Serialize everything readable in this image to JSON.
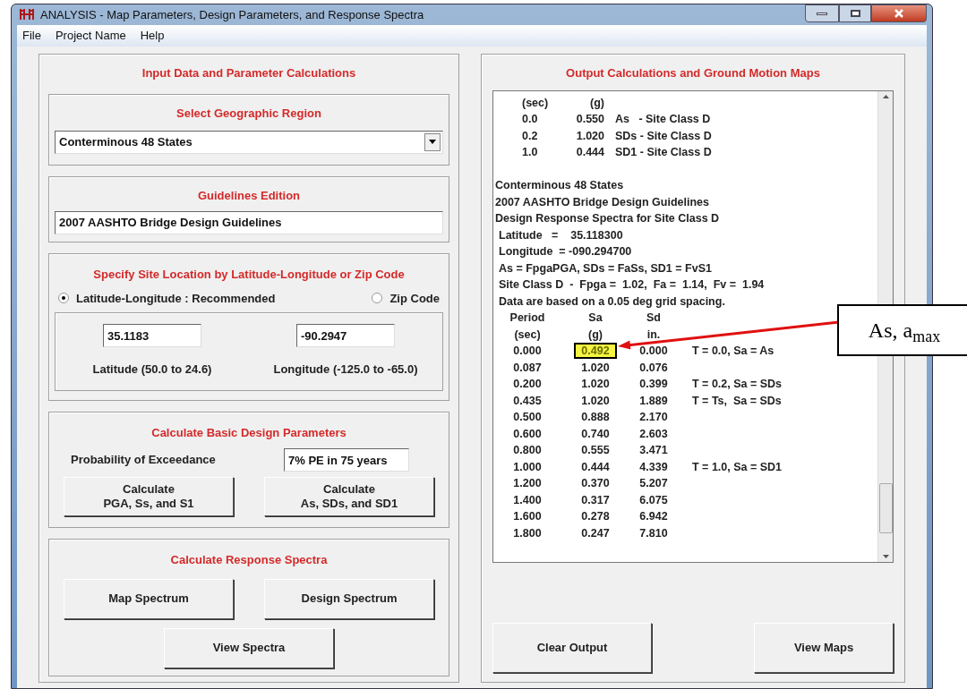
{
  "window": {
    "title": "ANALYSIS - Map Parameters, Design Parameters, and Response Spectra"
  },
  "menu": [
    "File",
    "Project Name",
    "Help"
  ],
  "input_panel": {
    "title": "Input Data and Parameter Calculations",
    "region": {
      "title": "Select Geographic Region",
      "value": "Conterminous 48 States"
    },
    "edition": {
      "title": "Guidelines Edition",
      "value": "2007 AASHTO Bridge Design Guidelines"
    },
    "site": {
      "title": "Specify Site Location by Latitude-Longitude or Zip Code",
      "options": [
        {
          "label": "Latitude-Longitude : Recommended",
          "selected": true
        },
        {
          "label": "Zip Code",
          "selected": false
        }
      ],
      "fields": [
        {
          "value": "35.1183",
          "label": "Latitude (50.0 to 24.6)"
        },
        {
          "value": "-90.2947",
          "label": "Longitude (-125.0 to -65.0)"
        }
      ]
    },
    "basic": {
      "title": "Calculate Basic Design Parameters",
      "probability_label": "Probability of Exceedance",
      "probability_value": "7% PE in 75 years",
      "buttons": [
        [
          "Calculate",
          "PGA, Ss, and S1"
        ],
        [
          "Calculate",
          "As, SDs, and SD1"
        ]
      ]
    },
    "spectra": {
      "title": "Calculate Response Spectra",
      "buttons": [
        "Map Spectrum",
        "Design Spectrum",
        "View Spectra"
      ]
    }
  },
  "output_panel": {
    "title": "Output Calculations and Ground Motion Maps",
    "lines": [
      {
        "kind": "summary",
        "cells": [
          "(sec)",
          "(g)"
        ]
      },
      {
        "kind": "summary",
        "cells": [
          "0.0",
          "0.550",
          "As   - Site Class D"
        ]
      },
      {
        "kind": "summary",
        "cells": [
          "0.2",
          "1.020",
          "SDs - Site Class D"
        ]
      },
      {
        "kind": "summary",
        "cells": [
          "1.0",
          "0.444",
          "SD1 - Site Class D"
        ]
      },
      {
        "kind": "blank"
      },
      {
        "kind": "text",
        "text": "Conterminous 48 States"
      },
      {
        "kind": "text",
        "text": "2007 AASHTO Bridge Design Guidelines"
      },
      {
        "kind": "text",
        "text": "Design Response Spectra for Site Class D"
      },
      {
        "kind": "indented",
        "text": "Latitude   =    35.118300"
      },
      {
        "kind": "indented",
        "text": "Longitude  = -090.294700"
      },
      {
        "kind": "indented",
        "text": "As = FpgaPGA, SDs = FaSs, SD1 = FvS1"
      },
      {
        "kind": "indented",
        "text": "Site Class D  -  Fpga =  1.02,  Fa =  1.14,  Fv =  1.94"
      },
      {
        "kind": "indented",
        "text": "Data are based on a 0.05 deg grid spacing."
      },
      {
        "kind": "spectra",
        "cells": [
          "Period",
          "Sa",
          "Sd"
        ],
        "highlighted": false
      },
      {
        "kind": "spectra",
        "cells": [
          "(sec)",
          "(g)",
          "in."
        ],
        "highlighted": false
      },
      {
        "kind": "spectra",
        "cells": [
          "0.000",
          "0.492",
          "0.000",
          "T = 0.0, Sa = As"
        ],
        "highlighted": true
      },
      {
        "kind": "spectra",
        "cells": [
          "0.087",
          "1.020",
          "0.076"
        ],
        "highlighted": false
      },
      {
        "kind": "spectra",
        "cells": [
          "0.200",
          "1.020",
          "0.399",
          "T = 0.2, Sa = SDs"
        ],
        "highlighted": false
      },
      {
        "kind": "spectra",
        "cells": [
          "0.435",
          "1.020",
          "1.889",
          "T = Ts,  Sa = SDs"
        ],
        "highlighted": false
      },
      {
        "kind": "spectra",
        "cells": [
          "0.500",
          "0.888",
          "2.170"
        ],
        "highlighted": false
      },
      {
        "kind": "spectra",
        "cells": [
          "0.600",
          "0.740",
          "2.603"
        ],
        "highlighted": false
      },
      {
        "kind": "spectra",
        "cells": [
          "0.800",
          "0.555",
          "3.471"
        ],
        "highlighted": false
      },
      {
        "kind": "spectra",
        "cells": [
          "1.000",
          "0.444",
          "4.339",
          "T = 1.0, Sa = SD1"
        ],
        "highlighted": false
      },
      {
        "kind": "spectra",
        "cells": [
          "1.200",
          "0.370",
          "5.207"
        ],
        "highlighted": false
      },
      {
        "kind": "spectra",
        "cells": [
          "1.400",
          "0.317",
          "6.075"
        ],
        "highlighted": false
      },
      {
        "kind": "spectra",
        "cells": [
          "1.600",
          "0.278",
          "6.942"
        ],
        "highlighted": false
      },
      {
        "kind": "spectra",
        "cells": [
          "1.800",
          "0.247",
          "7.810"
        ],
        "highlighted": false
      }
    ],
    "buttons": [
      "Clear Output",
      "View Maps"
    ]
  },
  "callout": {
    "text": "As, a$_{max}$"
  }
}
